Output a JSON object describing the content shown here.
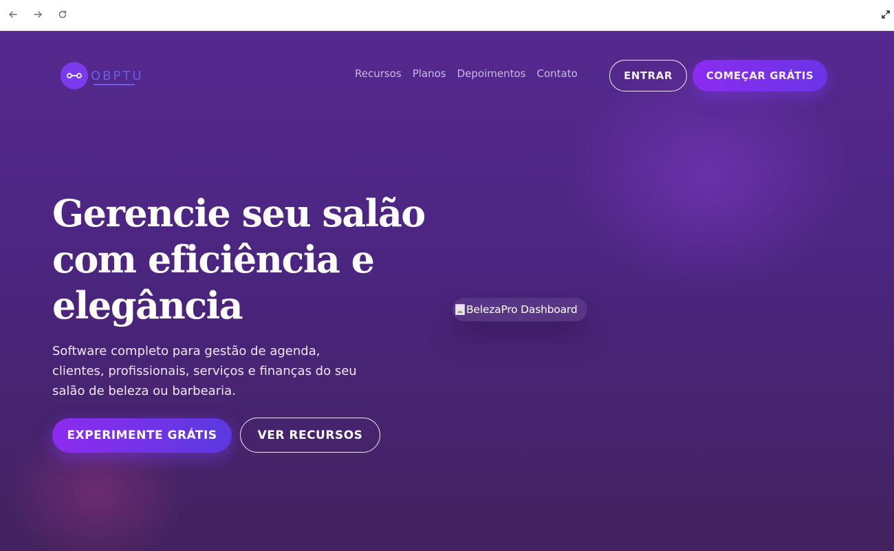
{
  "browser": {
    "back_icon": "arrow-left-icon",
    "forward_icon": "arrow-right-icon",
    "reload_icon": "reload-icon",
    "fullscreen_icon": "expand-icon"
  },
  "header": {
    "logo_text": "OBPTU",
    "logo_icon": "scissors-icon",
    "nav": [
      {
        "label": "Recursos"
      },
      {
        "label": "Planos"
      },
      {
        "label": "Depoimentos"
      },
      {
        "label": "Contato"
      }
    ],
    "login_label": "ENTRAR",
    "signup_label": "COMEÇAR GRÁTIS"
  },
  "hero": {
    "title_line1": "Gerencie seu salão",
    "title_line2": "com eficiência e",
    "title_line3": "elegância",
    "subtitle_line1": "Software completo para gestão de agenda,",
    "subtitle_line2": "clientes, profissionais, serviços e finanças do seu",
    "subtitle_line3": "salão de beleza ou barbearia.",
    "primary_cta": "EXPERIMENTE GRÁTIS",
    "secondary_cta": "VER RECURSOS",
    "image_alt": "BelezaPro Dashboard"
  },
  "colors": {
    "background_top": "#55298f",
    "background_bottom": "#43225e",
    "accent": "#7c3aed",
    "nav_text": "#c9b8e6"
  }
}
